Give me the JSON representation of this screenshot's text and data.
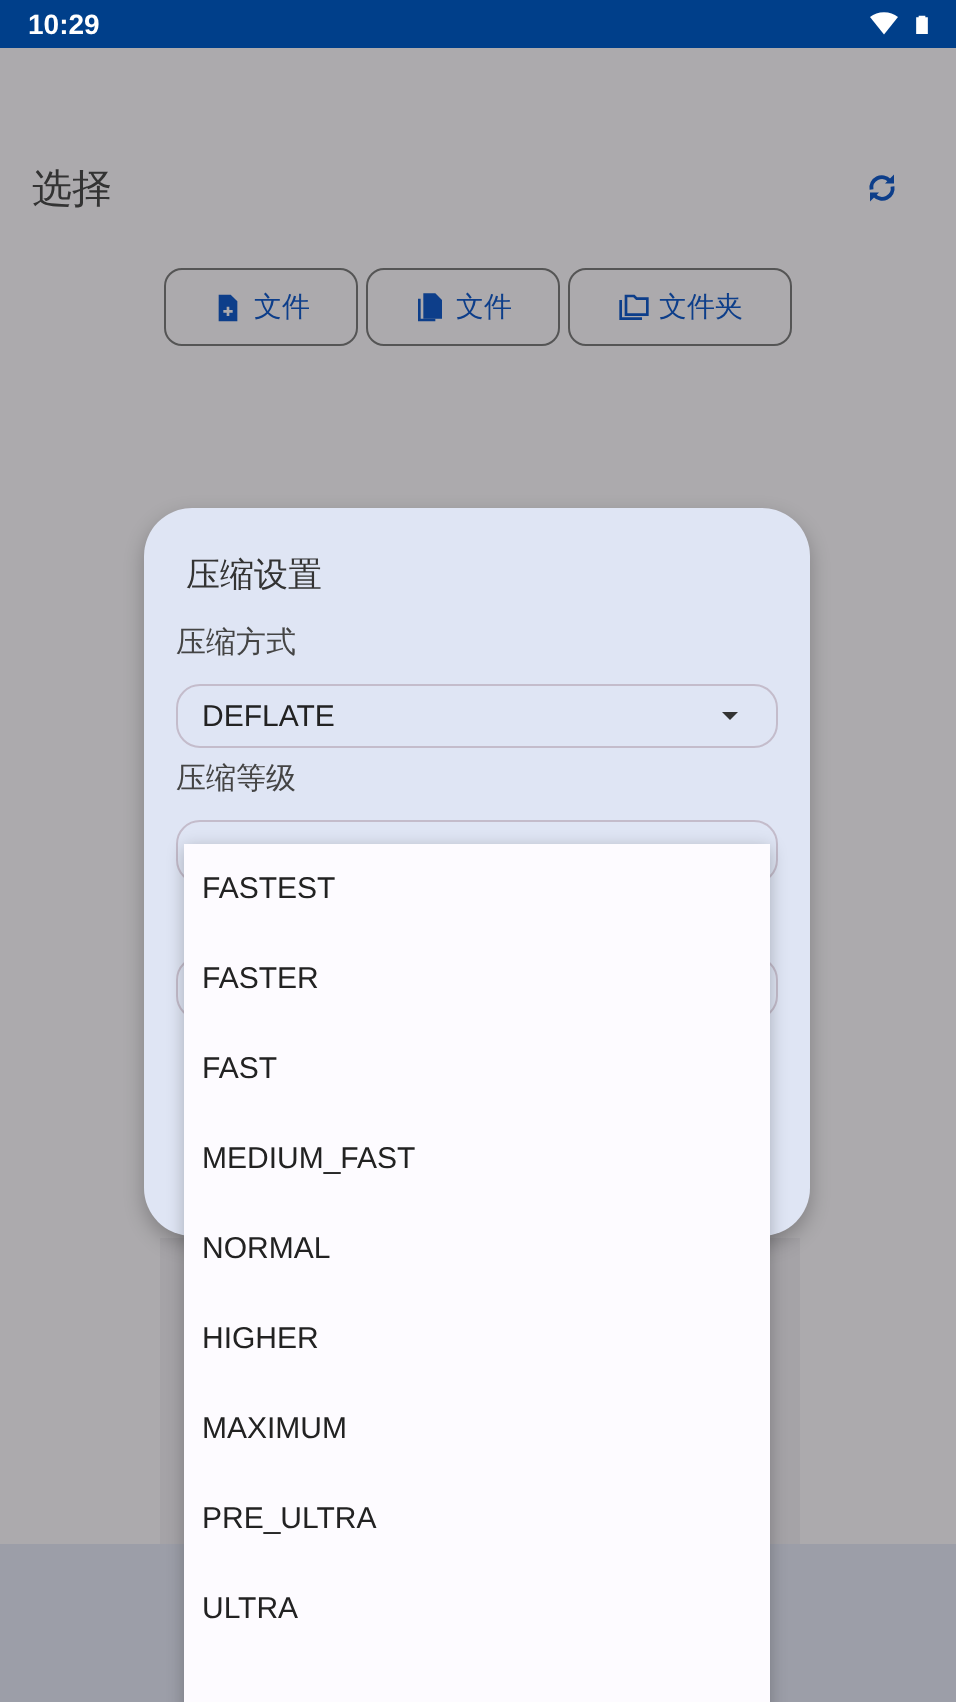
{
  "status_bar": {
    "time": "10:29"
  },
  "header": {
    "title": "选择"
  },
  "buttons": [
    {
      "kind": "new",
      "label": "文件"
    },
    {
      "kind": "multiple",
      "label": "文件"
    },
    {
      "kind": "folder",
      "label": "文件夹"
    }
  ],
  "dialog": {
    "title": "压缩设置",
    "fields": [
      {
        "label": "压缩方式",
        "value": "DEFLATE"
      },
      {
        "label": "压缩等级"
      }
    ]
  },
  "menu": {
    "items": [
      {
        "label": "FASTEST",
        "selected": false
      },
      {
        "label": "FASTER",
        "selected": false
      },
      {
        "label": "FAST",
        "selected": false
      },
      {
        "label": "MEDIUM_FAST",
        "selected": false
      },
      {
        "label": "NORMAL",
        "selected": false
      },
      {
        "label": "HIGHER",
        "selected": false
      },
      {
        "label": "MAXIMUM",
        "selected": false
      },
      {
        "label": "PRE_ULTRA",
        "selected": false
      },
      {
        "label": "ULTRA",
        "selected": false
      }
    ]
  }
}
